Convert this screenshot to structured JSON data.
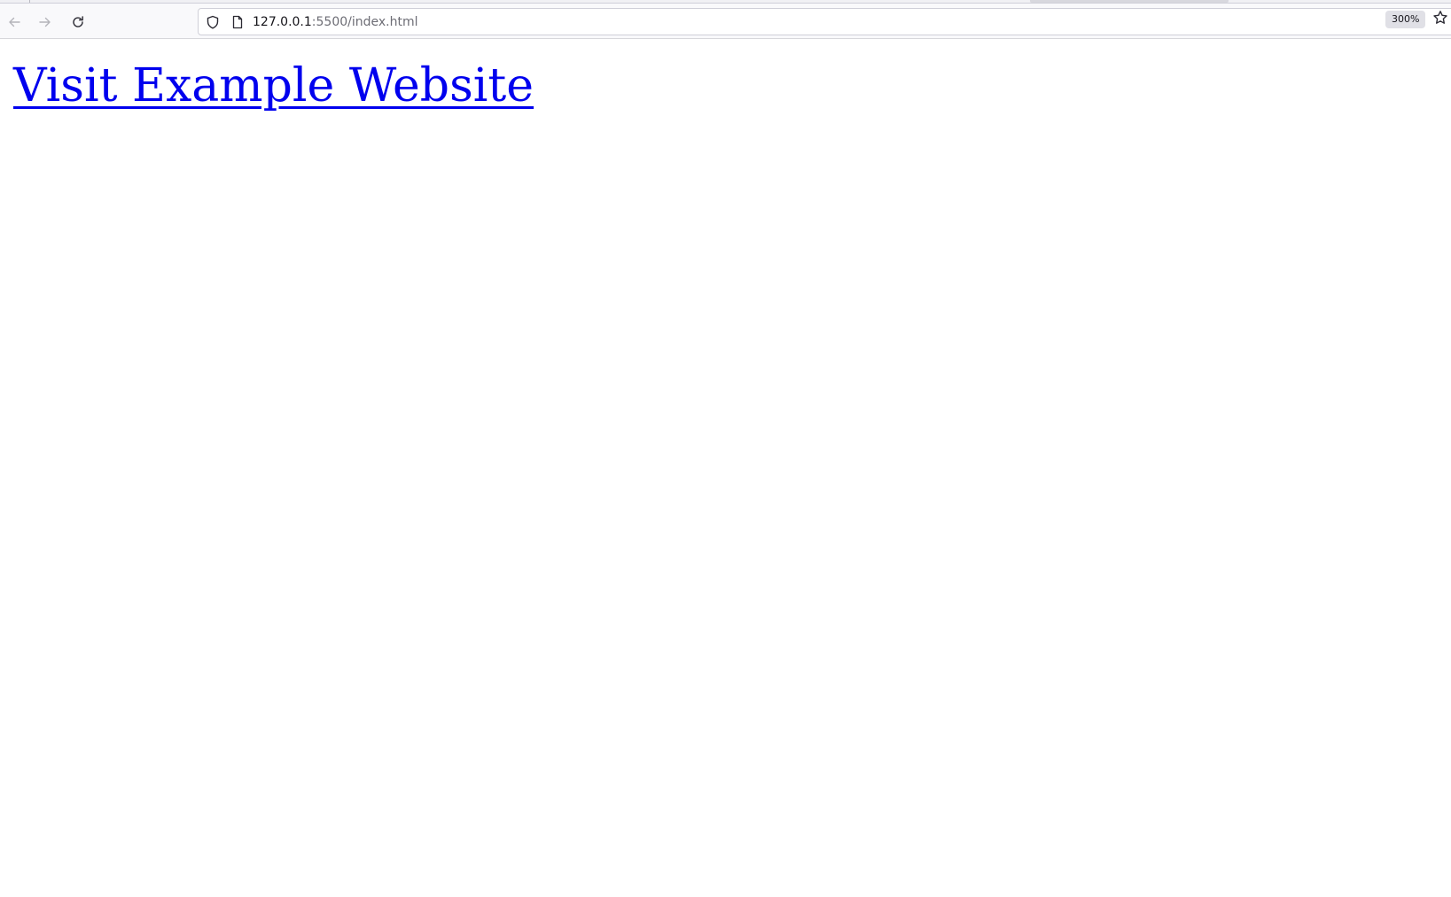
{
  "browser": {
    "url_host": "127.0.0.1",
    "url_path": ":5500/index.html",
    "zoom_level": "300%",
    "icons": {
      "back": "arrow-left-icon",
      "forward": "arrow-right-icon",
      "reload": "reload-icon",
      "tracking_protection": "shield-icon",
      "page_info": "page-icon",
      "bookmark": "star-icon"
    }
  },
  "page": {
    "link_text": "Visit Example Website",
    "link_color": "#0000ee"
  }
}
